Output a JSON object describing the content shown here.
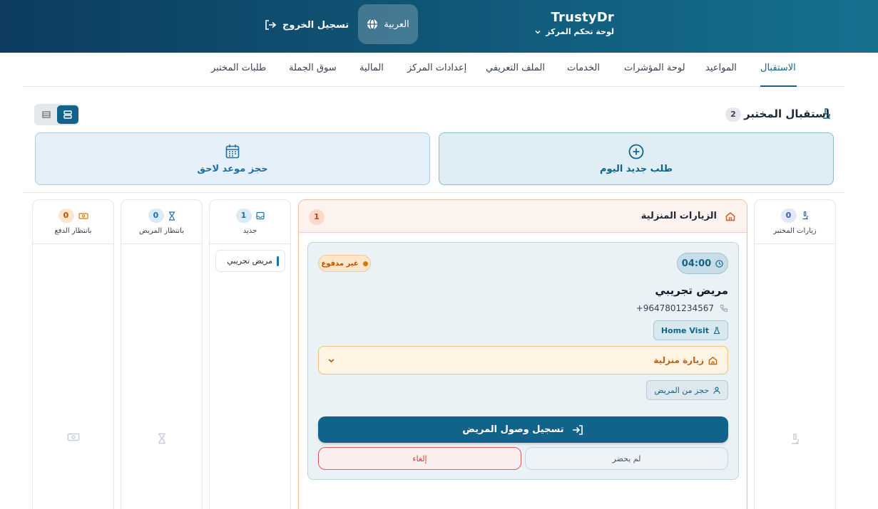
{
  "header": {
    "brand": "TrustyDr",
    "subtitle": "لوحة تحكم المركز",
    "language": "العربية",
    "logout": "تسجيل الخروج"
  },
  "tabs": [
    {
      "label": "الاستقبال",
      "active": true
    },
    {
      "label": "المواعيد"
    },
    {
      "label": "لوحة المؤشرات"
    },
    {
      "label": "الخدمات"
    },
    {
      "label": "الملف التعريفي"
    },
    {
      "label": "إعدادات المركز"
    },
    {
      "label": "المالية"
    },
    {
      "label": "سوق الجملة"
    },
    {
      "label": "طلبات المختبر"
    }
  ],
  "section": {
    "title": "استقبال المختبر",
    "count": "2"
  },
  "actions": {
    "today": "طلب جديد اليوم",
    "later": "حجز موعد لاحق"
  },
  "columns": {
    "lab_visits": {
      "label": "زيارات المختبر",
      "count": "0"
    },
    "home_visits": {
      "label": "الزيارات المنزلية",
      "count": "1"
    },
    "new": {
      "label": "جديد",
      "count": "1",
      "item": "مريض تجريبي"
    },
    "waiting_patient": {
      "label": "بانتظار المريض",
      "count": "0"
    },
    "waiting_payment": {
      "label": "بانتظار الدفع",
      "count": "0"
    }
  },
  "visit_card": {
    "time": "04:00",
    "payment_status": "غير مدفوع",
    "patient_name": "مريض تجريبي",
    "phone": "+9647801234567",
    "visit_type_badge": "Home Visit",
    "home_visit_label": "زيارة منزلية",
    "booked_by": "حجز من المريض",
    "checkin": "تسجيل وصول المريض",
    "no_show": "لم يحضر",
    "cancel": "إلغاء"
  },
  "colors": {
    "primary": "#12638a",
    "home_accent": "#dc5a2a",
    "unpaid": "#d97706",
    "cancel": "#d63c3c"
  }
}
